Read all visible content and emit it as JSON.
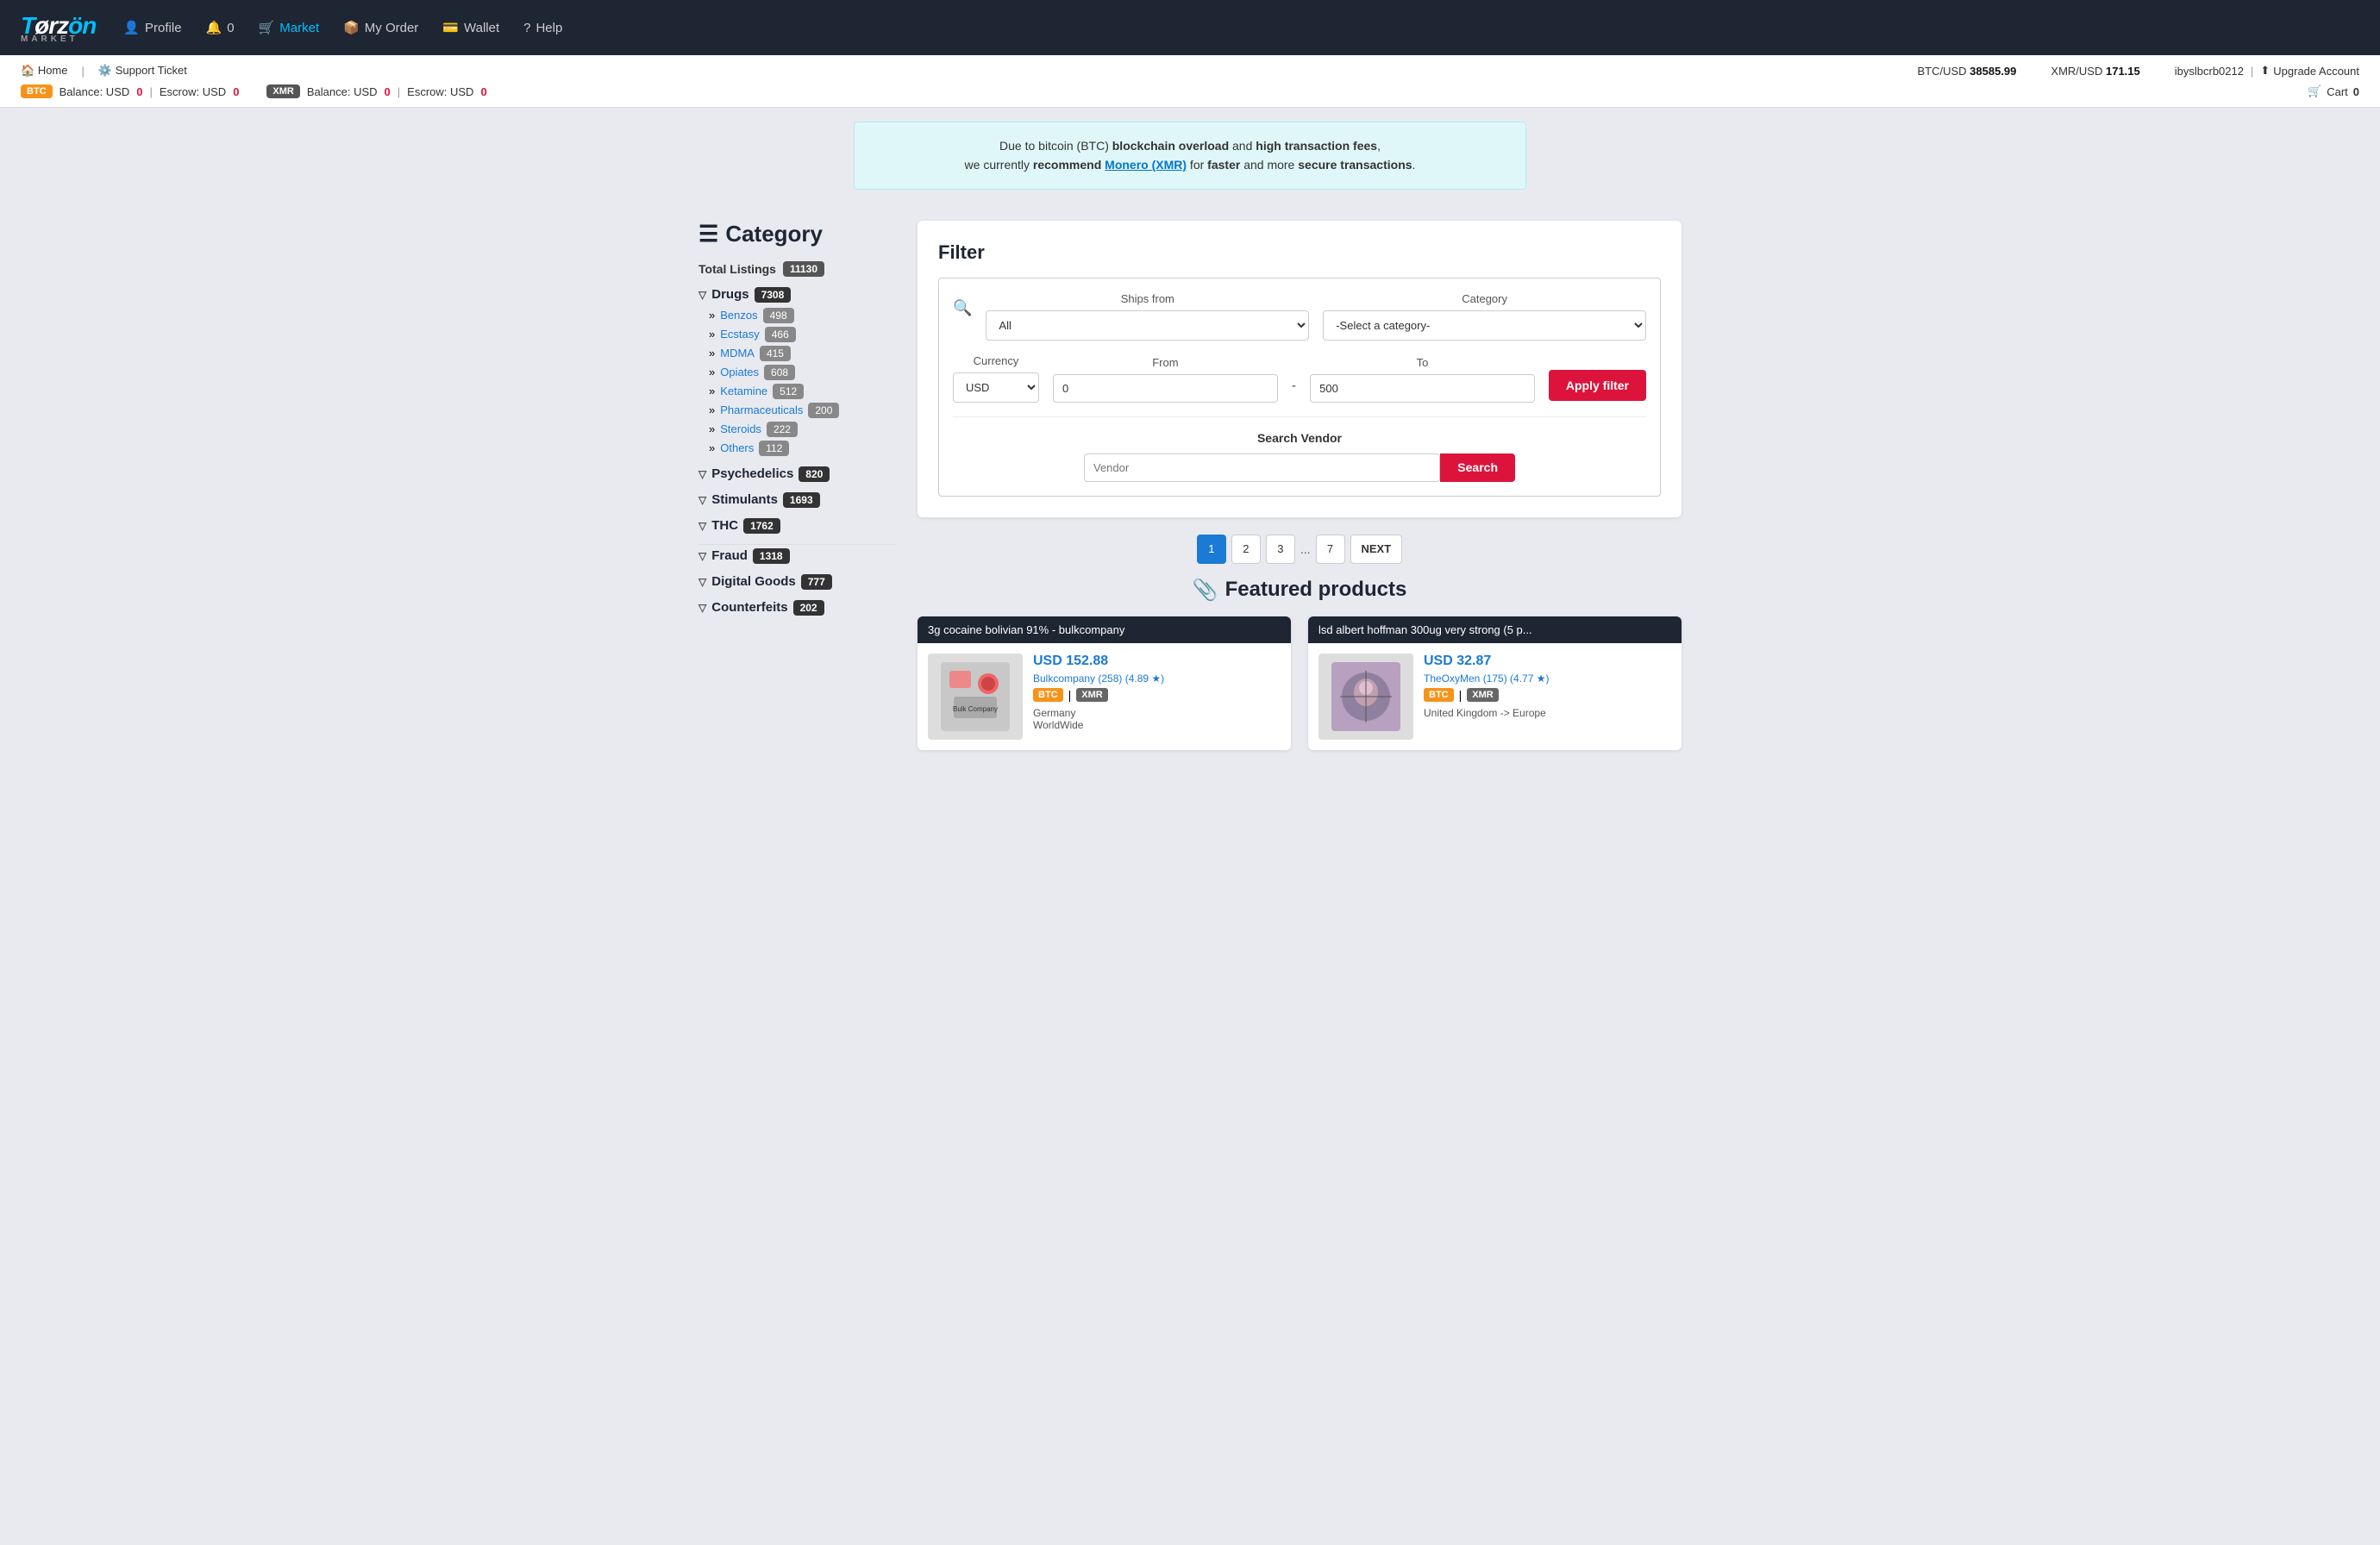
{
  "site": {
    "name": "Torzon",
    "sub": "MARKET"
  },
  "navbar": {
    "links": [
      {
        "id": "profile",
        "label": "Profile",
        "icon": "👤",
        "active": false
      },
      {
        "id": "notifications",
        "label": "0",
        "icon": "🔔",
        "active": false
      },
      {
        "id": "market",
        "label": "Market",
        "icon": "🛒",
        "active": true
      },
      {
        "id": "myorder",
        "label": "My Order",
        "icon": "📦",
        "active": false
      },
      {
        "id": "wallet",
        "label": "Wallet",
        "icon": "💳",
        "active": false
      },
      {
        "id": "help",
        "label": "Help",
        "icon": "?",
        "active": false
      }
    ]
  },
  "topbar": {
    "home_label": "Home",
    "support_label": "Support Ticket",
    "btc_rate_label": "BTC/USD",
    "btc_rate_value": "38585.99",
    "xmr_rate_label": "XMR/USD",
    "xmr_rate_value": "171.15",
    "username": "ibyslbcrb0212",
    "upgrade_label": "Upgrade Account",
    "btc_balance_label": "Balance: USD",
    "btc_balance_value": "0",
    "btc_escrow_label": "Escrow: USD",
    "btc_escrow_value": "0",
    "xmr_balance_label": "Balance: USD",
    "xmr_balance_value": "0",
    "xmr_escrow_label": "Escrow: USD",
    "xmr_escrow_value": "0",
    "cart_label": "Cart",
    "cart_count": "0"
  },
  "notice": {
    "text1": "Due to bitcoin (BTC) ",
    "bold1": "blockchain overload",
    "text2": " and ",
    "bold2": "high transaction fees",
    "text3": ", we currently ",
    "bold3": "recommend ",
    "link": "Monero (XMR)",
    "text4": " for ",
    "bold4": "faster",
    "text5": " and more ",
    "bold5": "secure transactions",
    "text6": "."
  },
  "sidebar": {
    "title": "Category",
    "total_label": "Total Listings",
    "total_count": "11130",
    "categories": [
      {
        "id": "drugs",
        "label": "Drugs",
        "count": "7308",
        "expanded": true,
        "subcategories": [
          {
            "id": "benzos",
            "label": "Benzos",
            "count": "498"
          },
          {
            "id": "ecstasy",
            "label": "Ecstasy",
            "count": "466"
          },
          {
            "id": "mdma",
            "label": "MDMA",
            "count": "415"
          },
          {
            "id": "opiates",
            "label": "Opiates",
            "count": "608"
          },
          {
            "id": "ketamine",
            "label": "Ketamine",
            "count": "512"
          },
          {
            "id": "pharmaceuticals",
            "label": "Pharmaceuticals",
            "count": "200"
          },
          {
            "id": "steroids",
            "label": "Steroids",
            "count": "222"
          },
          {
            "id": "others",
            "label": "Others",
            "count": "112"
          }
        ]
      },
      {
        "id": "psychedelics",
        "label": "Psychedelics",
        "count": "820",
        "expanded": false,
        "subcategories": []
      },
      {
        "id": "stimulants",
        "label": "Stimulants",
        "count": "1693",
        "expanded": false,
        "subcategories": []
      },
      {
        "id": "thc",
        "label": "THC",
        "count": "1762",
        "expanded": false,
        "subcategories": []
      },
      {
        "id": "fraud",
        "label": "Fraud",
        "count": "1318",
        "expanded": false,
        "subcategories": []
      },
      {
        "id": "digital-goods",
        "label": "Digital Goods",
        "count": "777",
        "expanded": false,
        "subcategories": []
      },
      {
        "id": "counterfeits",
        "label": "Counterfeits",
        "count": "202",
        "expanded": false,
        "subcategories": []
      }
    ]
  },
  "filter": {
    "title": "Filter",
    "ships_from_label": "Ships from",
    "ships_from_default": "All",
    "category_label": "Category",
    "category_default": "-Select a category-",
    "currency_label": "Currency",
    "currency_default": "USD",
    "from_label": "From",
    "from_value": "0",
    "to_label": "To",
    "to_value": "500",
    "apply_label": "Apply filter",
    "vendor_label": "Search Vendor",
    "vendor_placeholder": "Vendor",
    "search_label": "Search"
  },
  "pagination": {
    "pages": [
      "1",
      "2",
      "3",
      "...",
      "7"
    ],
    "active": "1",
    "next_label": "NEXT"
  },
  "featured": {
    "title": "Featured products",
    "products": [
      {
        "id": "product-1",
        "title": "3g cocaine bolivian 91% - bulkcompany",
        "price": "USD 152.88",
        "vendor": "Bulkcompany (258) (4.89 ★)",
        "coins": [
          "BTC",
          "XMR"
        ],
        "origin": "Germany",
        "destination": "WorldWide",
        "image_label": "cocaine product image"
      },
      {
        "id": "product-2",
        "title": "lsd albert hoffman 300ug very strong (5 p...",
        "price": "USD 32.87",
        "vendor": "TheOxyMen (175) (4.77 ★)",
        "coins": [
          "BTC",
          "XMR"
        ],
        "origin": "United Kingdom -> Europe",
        "destination": "",
        "image_label": "lsd product image"
      }
    ]
  }
}
